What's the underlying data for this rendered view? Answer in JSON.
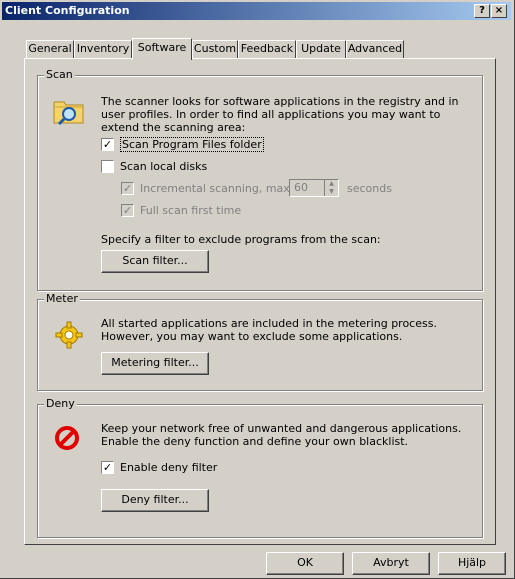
{
  "window": {
    "title": "Client Configuration",
    "help_btn": "?",
    "close_btn": "×"
  },
  "tabs": [
    "General",
    "Inventory",
    "Software",
    "Custom",
    "Feedback",
    "Update",
    "Advanced"
  ],
  "scan": {
    "label": "Scan",
    "description": "The scanner looks for software applications in the registry and in user profiles. In order to find all applications you may want to extend the scanning area:",
    "opt_program_files": {
      "label": "Scan Program Files folder",
      "checked": true
    },
    "opt_local_disks": {
      "label": "Scan local disks",
      "checked": false
    },
    "opt_incremental": {
      "label": "Incremental scanning, max:",
      "checked": true,
      "enabled": false
    },
    "max_value": "60",
    "seconds_label": "seconds",
    "opt_full_first": {
      "label": "Full scan first time",
      "checked": true,
      "enabled": false
    },
    "filter_text": "Specify a filter to exclude programs from the scan:",
    "filter_button": "Scan filter..."
  },
  "meter": {
    "label": "Meter",
    "description": "All started applications are included in the metering process. However, you may want to exclude some applications.",
    "filter_button": "Metering filter..."
  },
  "deny": {
    "label": "Deny",
    "description": "Keep your network free of unwanted and dangerous applications. Enable the deny function and define your own blacklist.",
    "opt_enable": {
      "label": "Enable deny filter",
      "checked": true
    },
    "filter_button": "Deny filter..."
  },
  "footer": {
    "ok": "OK",
    "cancel": "Avbryt",
    "help": "Hjälp"
  },
  "icons": {
    "scan": "folder-search-icon",
    "meter": "gear-icon",
    "deny": "no-entry-icon"
  }
}
